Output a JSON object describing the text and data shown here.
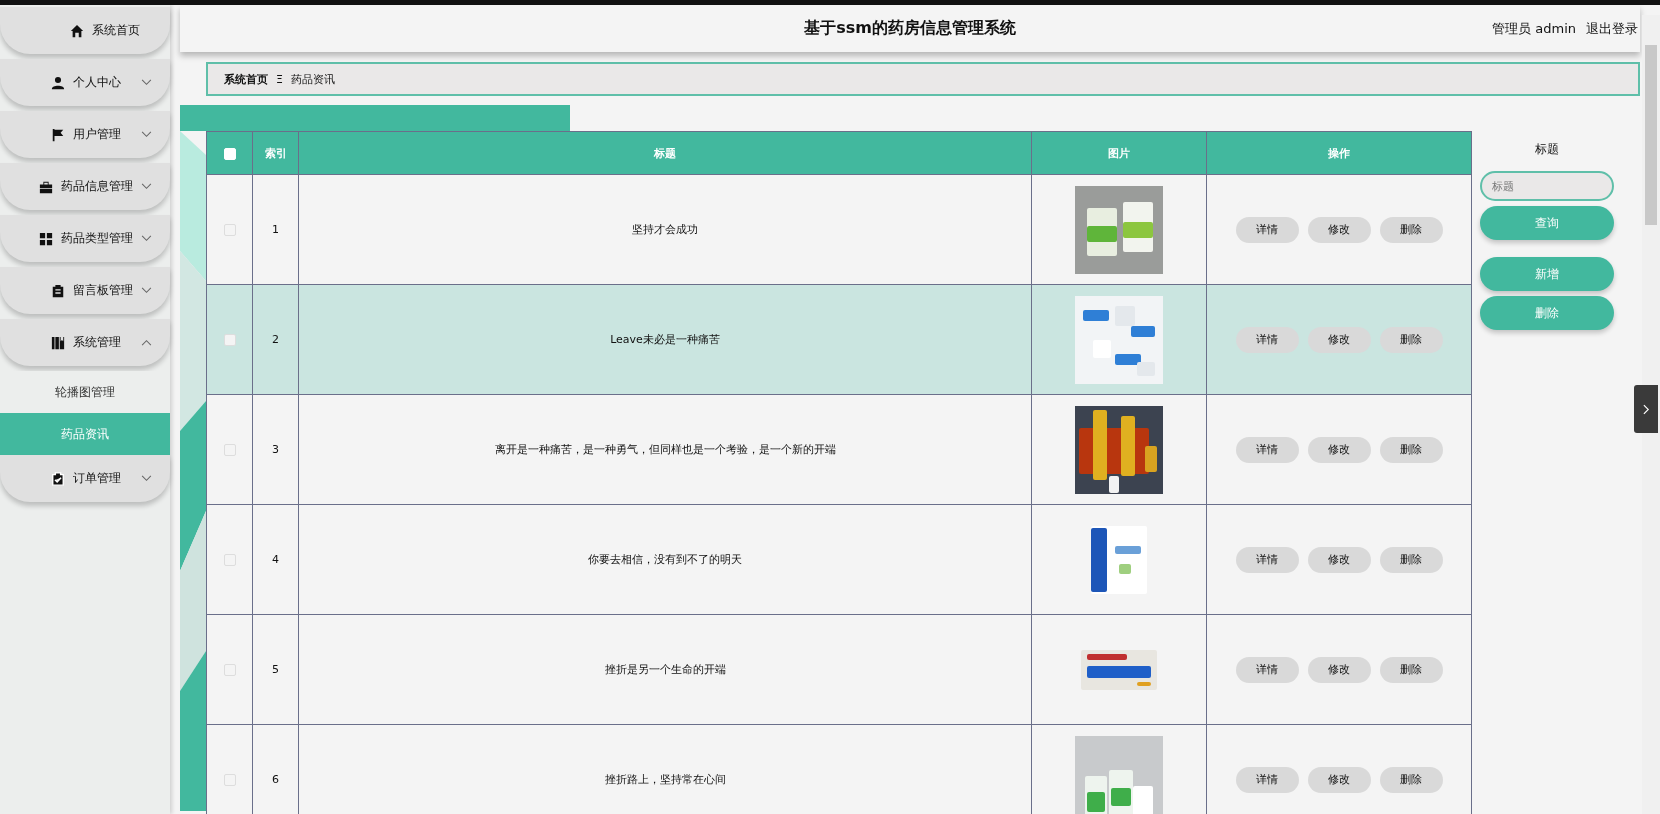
{
  "header": {
    "title": "基于ssm的药房信息管理系统",
    "user": "管理员 admin",
    "logout": "退出登录"
  },
  "sidebar": {
    "items": [
      {
        "label": "系统首页",
        "kind": "link"
      },
      {
        "label": "个人中心",
        "kind": "menu",
        "expanded": false
      },
      {
        "label": "用户管理",
        "kind": "menu",
        "expanded": false
      },
      {
        "label": "药品信息管理",
        "kind": "menu",
        "expanded": false
      },
      {
        "label": "药品类型管理",
        "kind": "menu",
        "expanded": false
      },
      {
        "label": "留言板管理",
        "kind": "menu",
        "expanded": false
      },
      {
        "label": "系统管理",
        "kind": "menu",
        "expanded": true,
        "children": [
          {
            "label": "轮播图管理",
            "selected": false
          },
          {
            "label": "药品资讯",
            "selected": true
          }
        ]
      },
      {
        "label": "订单管理",
        "kind": "menu",
        "expanded": false
      }
    ]
  },
  "breadcrumb": {
    "home": "系统首页",
    "separator": "Ξ",
    "current": "药品资讯"
  },
  "table": {
    "select_all": {
      "checked": false
    },
    "columns": [
      "索引",
      "标题",
      "图片",
      "操作"
    ],
    "rows": [
      {
        "checked": false,
        "selected": false,
        "index": "1",
        "title": "坚持才会成功",
        "image": {
          "kind": "picture"
        },
        "actions": [
          "详情",
          "修改",
          "删除"
        ]
      },
      {
        "checked": false,
        "selected": true,
        "index": "2",
        "title": "Leave未必是一种痛苦",
        "image": {
          "kind": "picture"
        },
        "actions": [
          "详情",
          "修改",
          "删除"
        ]
      },
      {
        "checked": false,
        "selected": false,
        "index": "3",
        "title": "离开是一种痛苦，是一种勇气，但同样也是一个考验，是一个新的开端",
        "image": {
          "kind": "picture"
        },
        "actions": [
          "详情",
          "修改",
          "删除"
        ]
      },
      {
        "checked": false,
        "selected": false,
        "index": "4",
        "title": "你要去相信，没有到不了的明天",
        "image": {
          "kind": "picture"
        },
        "actions": [
          "详情",
          "修改",
          "删除"
        ]
      },
      {
        "checked": false,
        "selected": false,
        "index": "5",
        "title": "挫折是另一个生命的开端",
        "image": {
          "kind": "picture"
        },
        "actions": [
          "详情",
          "修改",
          "删除"
        ]
      },
      {
        "checked": false,
        "selected": false,
        "index": "6",
        "title": "挫折路上，坚持常在心间",
        "image": {
          "kind": "picture"
        },
        "actions": [
          "详情",
          "修改",
          "删除"
        ]
      }
    ]
  },
  "search": {
    "label": "标题",
    "placeholder": "标题",
    "buttons": [
      "查询",
      "新增",
      "删除"
    ]
  }
}
